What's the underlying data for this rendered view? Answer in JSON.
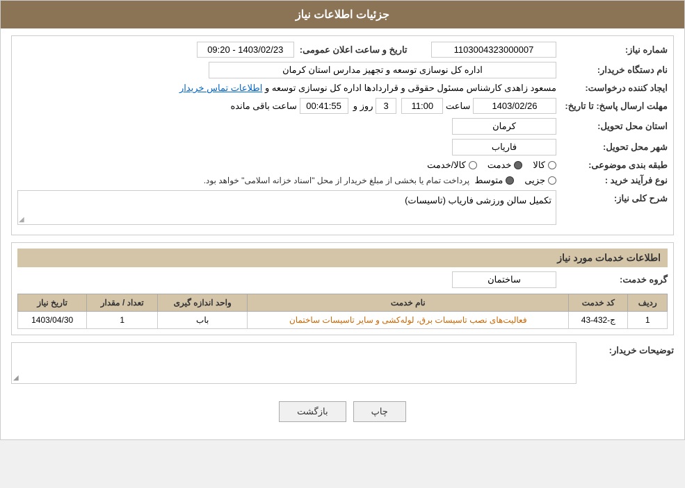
{
  "header": {
    "title": "جزئیات اطلاعات نیاز"
  },
  "need_details": {
    "need_number_label": "شماره نیاز:",
    "need_number_value": "1103004323000007",
    "date_label": "تاریخ و ساعت اعلان عمومی:",
    "date_value": "1403/02/23 - 09:20",
    "buyer_org_label": "نام دستگاه خریدار:",
    "buyer_org_value": "اداره کل نوسازی  توسعه و تجهیز مدارس استان کرمان",
    "creator_label": "ایجاد کننده درخواست:",
    "creator_value": "مسعود زاهدی کارشناس مسئول حقوقی و قراردادها اداره کل نوسازی  توسعه و",
    "creator_link": "اطلاعات تماس خریدار",
    "response_deadline_label": "مهلت ارسال پاسخ: تا تاریخ:",
    "response_date": "1403/02/26",
    "response_time_label": "ساعت",
    "response_time": "11:00",
    "days_label": "روز و",
    "days_value": "3",
    "remaining_label": "ساعت باقی مانده",
    "remaining_value": "00:41:55",
    "province_label": "استان محل تحویل:",
    "province_value": "کرمان",
    "city_label": "شهر محل تحویل:",
    "city_value": "فاریاب",
    "category_label": "طبقه بندی موضوعی:",
    "category_kala": "کالا",
    "category_khedmat": "خدمت",
    "category_kala_khedmat": "کالا/خدمت",
    "category_selected": "khedmat",
    "purchase_type_label": "نوع فرآیند خرید :",
    "purchase_jozvi": "جزیی",
    "purchase_mottaset": "متوسط",
    "purchase_desc": "پرداخت تمام یا بخشی از مبلغ خریدار از محل \"اسناد خزانه اسلامی\" خواهد بود.",
    "general_desc_label": "شرح کلی نیاز:",
    "general_desc_value": "تکمیل سالن ورزشی فاریاب (تاسیسات)"
  },
  "services_section": {
    "title": "اطلاعات خدمات مورد نیاز",
    "service_group_label": "گروه خدمت:",
    "service_group_value": "ساختمان",
    "table": {
      "headers": [
        "ردیف",
        "کد خدمت",
        "نام خدمت",
        "واحد اندازه گیری",
        "تعداد / مقدار",
        "تاریخ نیاز"
      ],
      "rows": [
        {
          "row_num": "1",
          "code": "ج-432-43",
          "name": "فعالیت‌های نصب تاسیسات برق، لوله‌کشی و سایر تاسیسات ساختمان",
          "unit": "باب",
          "quantity": "1",
          "date": "1403/04/30"
        }
      ]
    }
  },
  "buyer_comments": {
    "label": "توضیحات خریدار:",
    "value": ""
  },
  "buttons": {
    "print": "چاپ",
    "back": "بازگشت"
  }
}
